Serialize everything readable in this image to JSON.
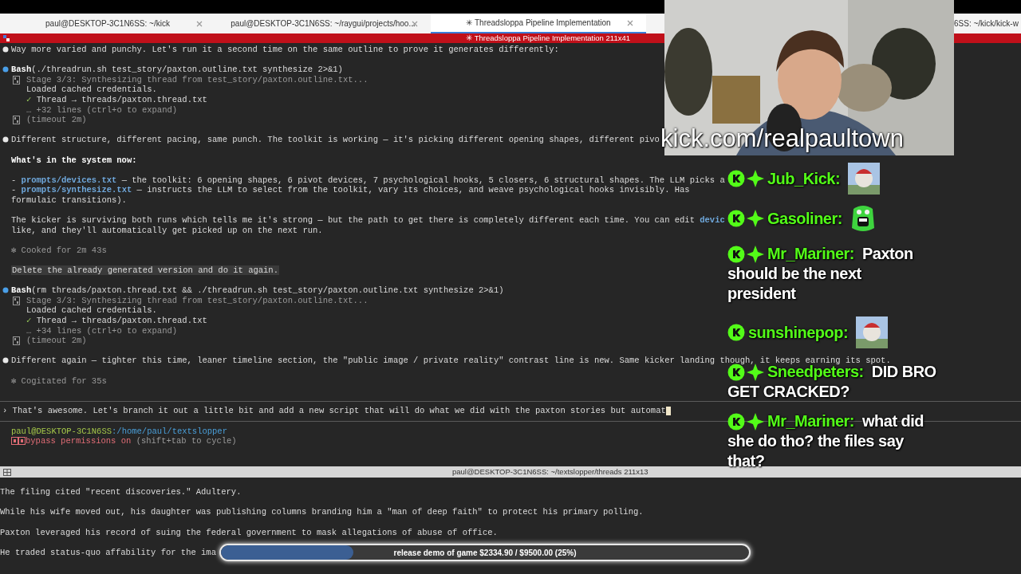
{
  "tabs": [
    {
      "label": "paul@DESKTOP-3C1N6SS: ~/kick",
      "selected": false
    },
    {
      "label": "paul@DESKTOP-3C1N6SS: ~/raygui/projects/hoo...",
      "selected": false
    },
    {
      "label": "✳ Threadsloppa Pipeline Implementation",
      "selected": true
    },
    {
      "label": "6SS: ~/kick/kick-w",
      "selected": false
    }
  ],
  "title_bar": "✳ Threadsloppa Pipeline Implementation 211x41",
  "terminal_lines": [
    {
      "kind": "assistant",
      "segments": [
        {
          "text": "Way more varied and punchy. Let's run it a second time on the same outline to prove it generates differently:",
          "kind": "plain"
        }
      ]
    },
    {
      "kind": "blank"
    },
    {
      "kind": "tool",
      "segments": [
        {
          "text": "Bash",
          "kind": "bold"
        },
        {
          "text": "(./threadrun.sh test_story/paxton.outline.txt synthesize 2>&1)",
          "kind": "plain"
        }
      ]
    },
    {
      "kind": "output-first",
      "segments": [
        {
          "text": "Stage 3/3: Synthesizing thread from test_story/paxton.outline.txt...",
          "kind": "dim"
        }
      ]
    },
    {
      "kind": "output",
      "segments": [
        {
          "text": "Loaded cached credentials.",
          "kind": "plain"
        }
      ]
    },
    {
      "kind": "output",
      "segments": [
        {
          "text": "✓ ",
          "kind": "check"
        },
        {
          "text": "Thread → threads/paxton.thread.txt",
          "kind": "plain"
        }
      ]
    },
    {
      "kind": "output",
      "segments": [
        {
          "text": "… +32 lines (ctrl+o to expand)",
          "kind": "dim"
        }
      ]
    },
    {
      "kind": "output-first",
      "segments": [
        {
          "text": "(timeout 2m)",
          "kind": "dim"
        }
      ]
    },
    {
      "kind": "blank"
    },
    {
      "kind": "assistant",
      "segments": [
        {
          "text": "Different structure, different pacing, same punch. The toolkit is working — it's picking different opening shapes, different pivo",
          "kind": "plain"
        }
      ]
    },
    {
      "kind": "blank"
    },
    {
      "kind": "plain",
      "segments": [
        {
          "text": "What's in the system now:",
          "kind": "bold"
        }
      ]
    },
    {
      "kind": "blank"
    },
    {
      "kind": "plain",
      "segments": [
        {
          "text": "- ",
          "kind": "plain"
        },
        {
          "text": "prompts/devices.txt",
          "kind": "link"
        },
        {
          "text": " — the toolkit: 6 opening shapes, 6 pivot devices, 7 psychological hooks, 5 closers, 6 structural shapes. The LLM picks a",
          "kind": "plain"
        }
      ]
    },
    {
      "kind": "plain",
      "segments": [
        {
          "text": "- ",
          "kind": "plain"
        },
        {
          "text": "prompts/synthesize.txt",
          "kind": "link"
        },
        {
          "text": " — instructs the LLM to select from the toolkit, vary its choices, and weave psychological hooks invisibly. Has",
          "kind": "plain"
        }
      ]
    },
    {
      "kind": "plain",
      "segments": [
        {
          "text": "formulaic transitions).",
          "kind": "plain"
        }
      ]
    },
    {
      "kind": "blank"
    },
    {
      "kind": "plain",
      "segments": [
        {
          "text": "The kicker is surviving both runs which tells me it's strong — but the path to get there is completely different each time. You can edit ",
          "kind": "plain"
        },
        {
          "text": "devic",
          "kind": "link"
        }
      ]
    },
    {
      "kind": "plain",
      "segments": [
        {
          "text": "like, and they'll automatically get picked up on the next run.",
          "kind": "plain"
        }
      ]
    },
    {
      "kind": "blank"
    },
    {
      "kind": "plain",
      "segments": [
        {
          "text": "✻ Cooked for 2m 43s",
          "kind": "dim"
        }
      ]
    },
    {
      "kind": "blank"
    },
    {
      "kind": "user",
      "segments": [
        {
          "text": "Delete the already generated version and do it again.",
          "kind": "plain"
        }
      ]
    },
    {
      "kind": "blank"
    },
    {
      "kind": "tool",
      "segments": [
        {
          "text": "Bash",
          "kind": "bold"
        },
        {
          "text": "(rm threads/paxton.thread.txt && ./threadrun.sh test_story/paxton.outline.txt synthesize 2>&1)",
          "kind": "plain"
        }
      ]
    },
    {
      "kind": "output-first",
      "segments": [
        {
          "text": "Stage 3/3: Synthesizing thread from test_story/paxton.outline.txt...",
          "kind": "dim"
        }
      ]
    },
    {
      "kind": "output",
      "segments": [
        {
          "text": "Loaded cached credentials.",
          "kind": "plain"
        }
      ]
    },
    {
      "kind": "output",
      "segments": [
        {
          "text": "✓ ",
          "kind": "check"
        },
        {
          "text": "Thread → threads/paxton.thread.txt",
          "kind": "plain"
        }
      ]
    },
    {
      "kind": "output",
      "segments": [
        {
          "text": "… +34 lines (ctrl+o to expand)",
          "kind": "dim"
        }
      ]
    },
    {
      "kind": "output-first",
      "segments": [
        {
          "text": "(timeout 2m)",
          "kind": "dim"
        }
      ]
    },
    {
      "kind": "blank"
    },
    {
      "kind": "assistant",
      "segments": [
        {
          "text": "Different again — tighter this time, leaner timeline section, the \"public image / private reality\" contrast line is new. Same kicker landing though, it keeps earning its spot.",
          "kind": "plain"
        }
      ]
    },
    {
      "kind": "blank"
    },
    {
      "kind": "plain",
      "segments": [
        {
          "text": "✻ Cogitated for 35s",
          "kind": "dim"
        }
      ]
    },
    {
      "kind": "blank"
    },
    {
      "kind": "divider"
    },
    {
      "kind": "input",
      "segments": [
        {
          "text": "› That's awesome. Let's branch it out a little bit and add a new script that will do what we did with the paxton stories but automat",
          "kind": "plain"
        }
      ]
    },
    {
      "kind": "divider"
    },
    {
      "kind": "plain",
      "segments": [
        {
          "text": "paul@DESKTOP-3C1N6SS",
          "kind": "user-host"
        },
        {
          "text": ":/home/paul/textslopper",
          "kind": "path"
        }
      ]
    },
    {
      "kind": "mode",
      "segments": [
        {
          "text": "bypass permissions on",
          "kind": "warning"
        },
        {
          "text": " (shift+tab to cycle)",
          "kind": "dim"
        }
      ]
    }
  ],
  "lower_pane": {
    "title": "paul@DESKTOP-3C1N6SS: ~/textslopper/threads 211x13",
    "lines": [
      "The filing cited \"recent discoveries.\" Adultery.",
      "While his wife moved out, his daughter was publishing columns branding him a \"man of deep faith\" to protect his primary polling.",
      "Paxton leveraged his record of suing the federal government to mask allegations of abuse of office.",
      "He traded status-quo affability for the ima"
    ]
  },
  "stream": {
    "channel_url": "kick.com/realpaultown",
    "chat": [
      {
        "kind": "picture",
        "user": "Jub_Kick:",
        "subscriber": true
      },
      {
        "kind": "emote",
        "user": "Gasoliner:",
        "subscriber": true
      },
      {
        "kind": "text",
        "user": "Mr_Mariner:",
        "subscriber": true,
        "message_lines": [
          "Paxton",
          "should be the next",
          "president"
        ]
      },
      {
        "kind": "picture",
        "user": "sunshinepop:",
        "subscriber": false
      },
      {
        "kind": "text",
        "user": "Sneedpeters:",
        "subscriber": true,
        "message_lines": [
          "DID BRO",
          "GET CRACKED?"
        ]
      },
      {
        "kind": "text",
        "user": "Mr_Mariner:",
        "subscriber": true,
        "message_lines": [
          "what did",
          "she do tho? the files say",
          "that?"
        ]
      }
    ],
    "goal": {
      "label": "release demo of game $2334.90 / $9500.00 (25%)",
      "level": 0.25
    }
  }
}
